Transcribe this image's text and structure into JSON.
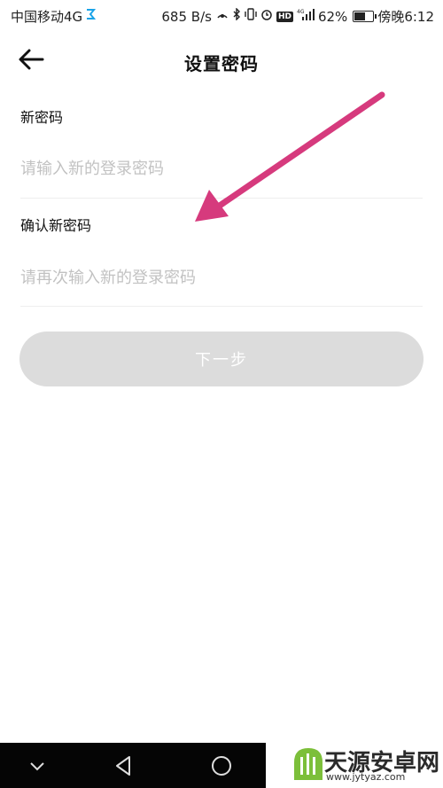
{
  "status_bar": {
    "carrier": "中国移动4G",
    "speed": "685 B/s",
    "battery": "62%",
    "battery_level": 0.62,
    "time": "傍晚6:12",
    "network_badge": "HD",
    "network_type": "4G"
  },
  "header": {
    "title": "设置密码",
    "back_icon": "arrow-left-icon"
  },
  "form": {
    "new_password_label": "新密码",
    "new_password_placeholder": "请输入新的登录密码",
    "new_password_value": "",
    "confirm_password_label": "确认新密码",
    "confirm_password_placeholder": "请再次输入新的登录密码",
    "confirm_password_value": ""
  },
  "next_button": {
    "label": "下一步"
  },
  "colors": {
    "button_disabled": "#dcdcdc",
    "annotation_arrow": "#d63a7d",
    "placeholder": "#c2c2c2"
  },
  "watermark": {
    "text": "天源安卓网",
    "url": "www.jytyaz.com"
  }
}
